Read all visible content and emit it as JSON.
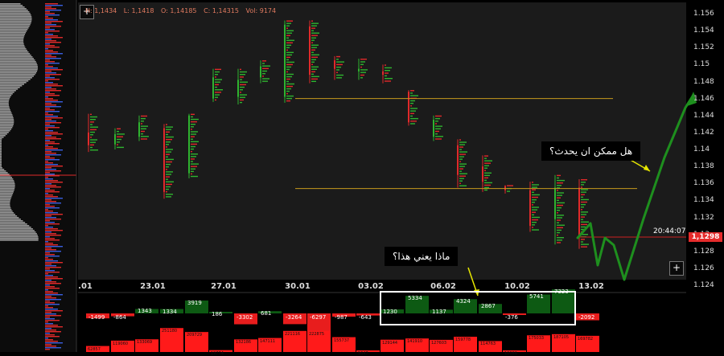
{
  "ohlc": {
    "high": "H: 1,1434",
    "low": "L: 1,1418",
    "open": "O: 1,14185",
    "close": "C: 1,14315",
    "volume": "Vol: 9174"
  },
  "chart_data": {
    "type": "line",
    "title": "",
    "price_ticks": [
      "1.156",
      "1.154",
      "1.152",
      "1.15",
      "1.148",
      "1.146",
      "1.144",
      "1.142",
      "1.14",
      "1.138",
      "1.136",
      "1.134",
      "1.132",
      "1.13",
      "1.128",
      "1.126",
      "1.124"
    ],
    "time_ticks": [
      ".01",
      "23.01",
      "27.01",
      "30.01",
      "03.02",
      "06.02",
      "10.02",
      "13.02"
    ],
    "ylim": [
      1.124,
      1.157
    ],
    "current_price": "1,1298",
    "candle_timer": "20:44:07",
    "levels": [
      1.146,
      1.1354
    ],
    "candles": [
      {
        "o": 1.142,
        "c": 1.1405,
        "h": 1.1442,
        "l": 1.1397
      },
      {
        "o": 1.1406,
        "c": 1.1418,
        "h": 1.1425,
        "l": 1.14
      },
      {
        "o": 1.1415,
        "c": 1.1432,
        "h": 1.144,
        "l": 1.141
      },
      {
        "o": 1.1425,
        "c": 1.135,
        "h": 1.143,
        "l": 1.1342
      },
      {
        "o": 1.1372,
        "c": 1.144,
        "h": 1.1442,
        "l": 1.1366
      },
      {
        "o": 1.146,
        "c": 1.1485,
        "h": 1.1495,
        "l": 1.1456
      },
      {
        "o": 1.1462,
        "c": 1.1482,
        "h": 1.1495,
        "l": 1.1453
      },
      {
        "o": 1.1485,
        "c": 1.1498,
        "h": 1.1505,
        "l": 1.1478
      },
      {
        "o": 1.1462,
        "c": 1.1547,
        "h": 1.1552,
        "l": 1.1455
      },
      {
        "o": 1.1545,
        "c": 1.1488,
        "h": 1.1552,
        "l": 1.1478
      },
      {
        "o": 1.1505,
        "c": 1.1495,
        "h": 1.151,
        "l": 1.1482
      },
      {
        "o": 1.1492,
        "c": 1.1495,
        "h": 1.1507,
        "l": 1.1482
      },
      {
        "o": 1.1492,
        "c": 1.1488,
        "h": 1.15,
        "l": 1.1478
      },
      {
        "o": 1.1468,
        "c": 1.1432,
        "h": 1.147,
        "l": 1.1428
      },
      {
        "o": 1.1415,
        "c": 1.1435,
        "h": 1.144,
        "l": 1.141
      },
      {
        "o": 1.1405,
        "c": 1.137,
        "h": 1.1412,
        "l": 1.1355
      },
      {
        "o": 1.138,
        "c": 1.1362,
        "h": 1.1393,
        "l": 1.135
      },
      {
        "o": 1.1357,
        "c": 1.1352,
        "h": 1.1358,
        "l": 1.1348
      },
      {
        "o": 1.1352,
        "c": 1.131,
        "h": 1.1362,
        "l": 1.1303
      },
      {
        "o": 1.1318,
        "c": 1.1355,
        "h": 1.137,
        "l": 1.1288
      },
      {
        "o": 1.1355,
        "c": 1.1298,
        "h": 1.1365,
        "l": 1.1283
      }
    ],
    "projection": [
      [
        718,
        296
      ],
      [
        734,
        278
      ],
      [
        743,
        330
      ],
      [
        752,
        296
      ],
      [
        763,
        305
      ],
      [
        776,
        348
      ],
      [
        800,
        272
      ],
      [
        826,
        196
      ],
      [
        852,
        134
      ],
      [
        862,
        118
      ]
    ]
  },
  "callouts": {
    "question1": "هل ممكن ان يحدث؟",
    "question2": "ماذا يعني هذا؟"
  },
  "delta": {
    "values": [
      "-1499",
      "-864",
      "1343",
      "1334",
      "3919",
      "186",
      "-3302",
      "681",
      "-3264",
      "-6297",
      "-987",
      "-643",
      "1230",
      "5334",
      "1137",
      "4324",
      "2867",
      "-376",
      "5741",
      "7323",
      "-2092"
    ]
  },
  "volume": {
    "values": [
      "62857",
      "119060",
      "133069",
      "251180",
      "209729",
      "19774",
      "132186",
      "147111",
      "221116",
      "222875",
      "155737",
      "5647",
      "129144",
      "141910",
      "127603",
      "159778",
      "114763",
      "10086",
      "175033",
      "187105",
      "169782"
    ]
  },
  "buttons": {
    "plus": "+"
  }
}
